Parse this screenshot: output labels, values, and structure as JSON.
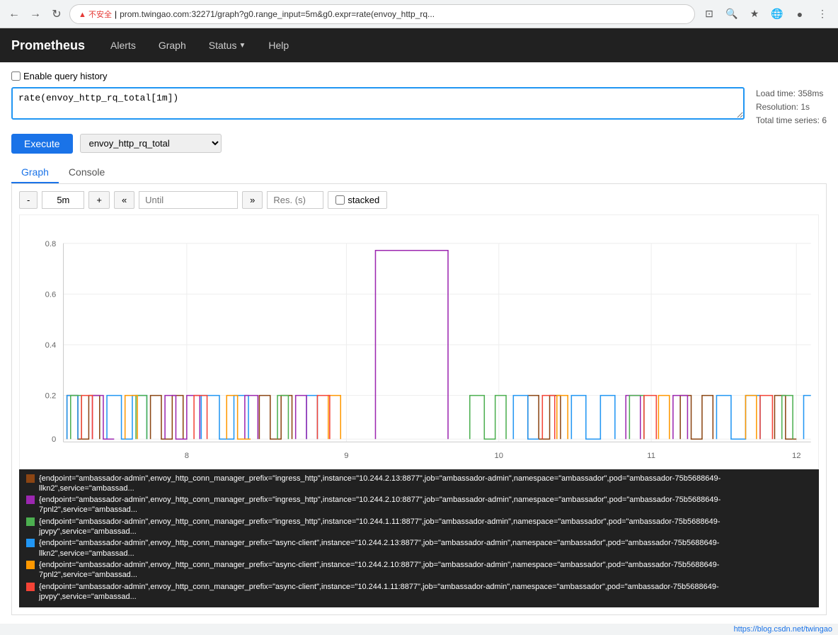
{
  "browser": {
    "url": "▲ 不安全 | prom.twingao.com:32271/graph?g0.range_input=5m&g0.expr=rate(envoy_http_rq...",
    "warning": "▲ 不安全",
    "separator": "|",
    "url_text": "prom.twingao.com:32271/graph?g0.range_input=5m&g0.expr=rate(envoy_http_rq...",
    "status_url": "https://blog.csdn.net/twingao"
  },
  "navbar": {
    "brand": "Prometheus",
    "links": [
      "Alerts",
      "Graph",
      "Status",
      "Help"
    ],
    "status_has_dropdown": true
  },
  "query_history": {
    "checkbox_label": "Enable query history"
  },
  "query": {
    "value": "rate(envoy_http_rq_total[1m])",
    "placeholder": ""
  },
  "meta": {
    "load_time": "Load time: 358ms",
    "resolution": "Resolution: 1s",
    "total_series": "Total time series: 6"
  },
  "execute": {
    "label": "Execute"
  },
  "metric_select": {
    "value": "envoy_http_rq_total",
    "options": [
      "envoy_http_rq_total"
    ]
  },
  "tabs": [
    {
      "label": "Graph",
      "active": true
    },
    {
      "label": "Console",
      "active": false
    }
  ],
  "graph_controls": {
    "minus": "-",
    "range": "5m",
    "plus": "+",
    "rewind": "«",
    "until": "Until",
    "forward": "»",
    "res_placeholder": "Res. (s)",
    "stacked_label": "stacked"
  },
  "chart": {
    "y_labels": [
      "0.8",
      "0.6",
      "0.4",
      "0.2",
      "0"
    ],
    "x_labels": [
      "8",
      "9",
      "10",
      "11",
      "12"
    ]
  },
  "legend": {
    "items": [
      {
        "color": "#8B4513",
        "text": "{endpoint=\"ambassador-admin\",envoy_http_conn_manager_prefix=\"ingress_http\",instance=\"10.244.2.13:8877\",job=\"ambassador-admin\",namespace=\"ambassador\",pod=\"ambassador-75b5688649-llkn2\",service=\"ambassad..."
      },
      {
        "color": "#9c27b0",
        "text": "{endpoint=\"ambassador-admin\",envoy_http_conn_manager_prefix=\"ingress_http\",instance=\"10.244.2.10:8877\",job=\"ambassador-admin\",namespace=\"ambassador\",pod=\"ambassador-75b5688649-7pnl2\",service=\"ambassad..."
      },
      {
        "color": "#4caf50",
        "text": "{endpoint=\"ambassador-admin\",envoy_http_conn_manager_prefix=\"ingress_http\",instance=\"10.244.1.11:8877\",job=\"ambassador-admin\",namespace=\"ambassador\",pod=\"ambassador-75b5688649-jpvpy\",service=\"ambassad..."
      },
      {
        "color": "#2196f3",
        "text": "{endpoint=\"ambassador-admin\",envoy_http_conn_manager_prefix=\"async-client\",instance=\"10.244.2.13:8877\",job=\"ambassador-admin\",namespace=\"ambassador\",pod=\"ambassador-75b5688649-llkn2\",service=\"ambassad..."
      },
      {
        "color": "#ff9800",
        "text": "{endpoint=\"ambassador-admin\",envoy_http_conn_manager_prefix=\"async-client\",instance=\"10.244.2.10:8877\",job=\"ambassador-admin\",namespace=\"ambassador\",pod=\"ambassador-75b5688649-7pnl2\",service=\"ambassad..."
      },
      {
        "color": "#f44336",
        "text": "{endpoint=\"ambassador-admin\",envoy_http_conn_manager_prefix=\"async-client\",instance=\"10.244.1.11:8877\",job=\"ambassador-admin\",namespace=\"ambassador\",pod=\"ambassador-75b5688649-jpvpy\",service=\"ambassad..."
      }
    ]
  }
}
